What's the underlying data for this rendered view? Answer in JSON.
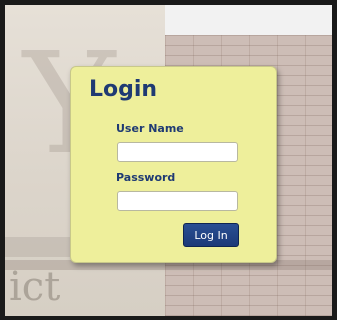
{
  "login": {
    "title": "Login",
    "username_label": "User Name",
    "username_value": "",
    "password_label": "Password",
    "password_value": "",
    "submit_label": "Log In"
  },
  "background": {
    "sign_letter": "Y",
    "sign_word": "ict"
  },
  "colors": {
    "panel_bg": "#eeef9b",
    "title_text": "#1f3a73",
    "button_bg": "#1c3a78",
    "button_text": "#ffffff"
  }
}
